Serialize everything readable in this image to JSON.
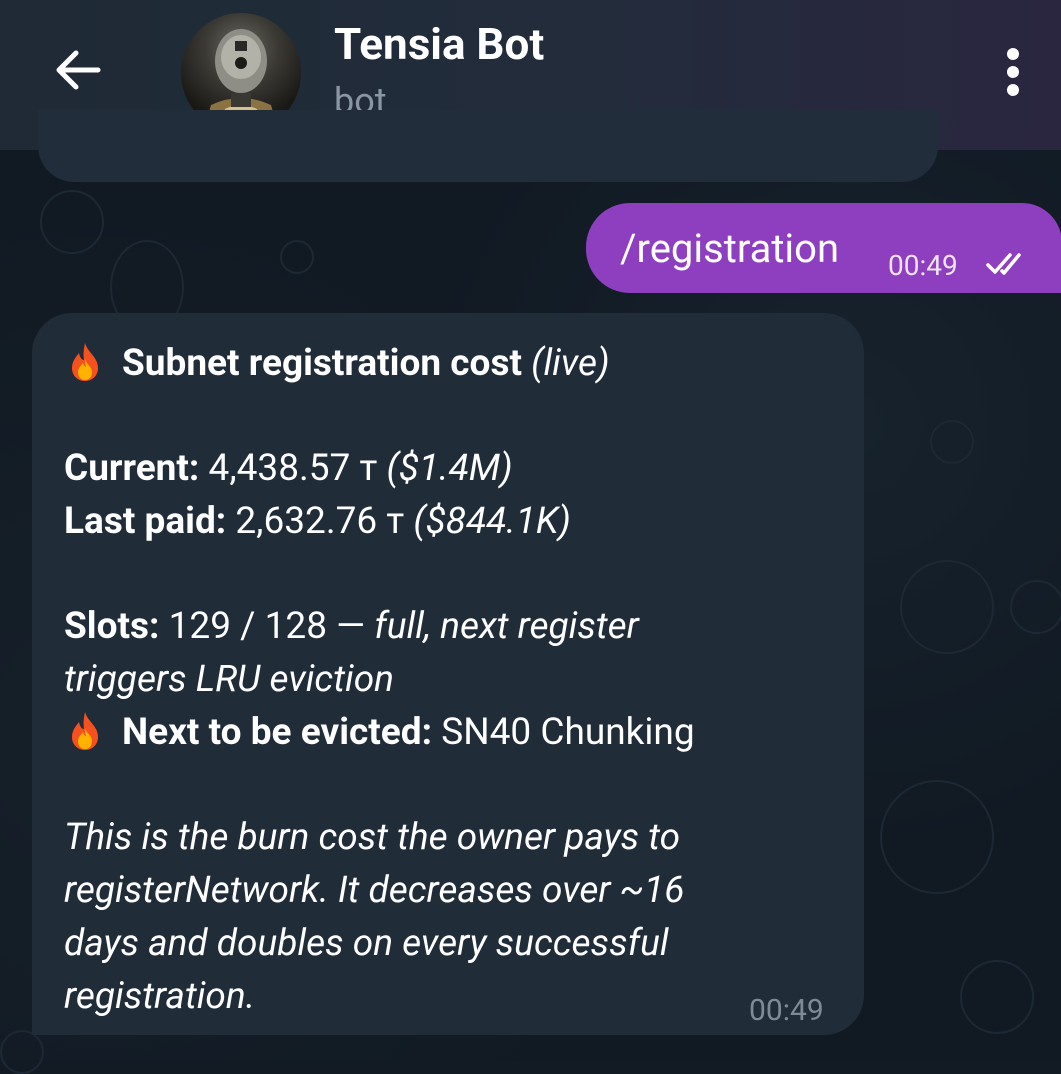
{
  "header": {
    "title": "Tensia Bot",
    "subtitle": "bot"
  },
  "outgoing": {
    "text": "/registration",
    "time": "00:49"
  },
  "incoming": {
    "heading": "Subnet registration cost",
    "heading_suffix": "(live)",
    "current_label": "Current:",
    "current_value": "4,438.57 т",
    "current_usd": "($1.4M)",
    "last_paid_label": "Last paid:",
    "last_paid_value": "2,632.76 т",
    "last_paid_usd": "($844.1K)",
    "slots_label": "Slots:",
    "slots_value": "129 / 128 —",
    "slots_note_1": "full, next register",
    "slots_note_2": "triggers LRU eviction",
    "evict_label": "Next to be evicted:",
    "evict_value": "SN40 Chunking",
    "footer_1": "This is the burn cost the owner pays to",
    "footer_2": "registerNetwork. It decreases over ~16",
    "footer_3": "days and doubles on every successful",
    "footer_4": "registration.",
    "time": "00:49"
  },
  "colors": {
    "outgoing_bubble": "#8e3fbf",
    "incoming_bubble": "#212c39",
    "header_bg": "#1f2a36",
    "background": "#111a23"
  },
  "icons": [
    "back-arrow-icon",
    "more-vert-icon",
    "double-check-icon",
    "fire-icon"
  ]
}
